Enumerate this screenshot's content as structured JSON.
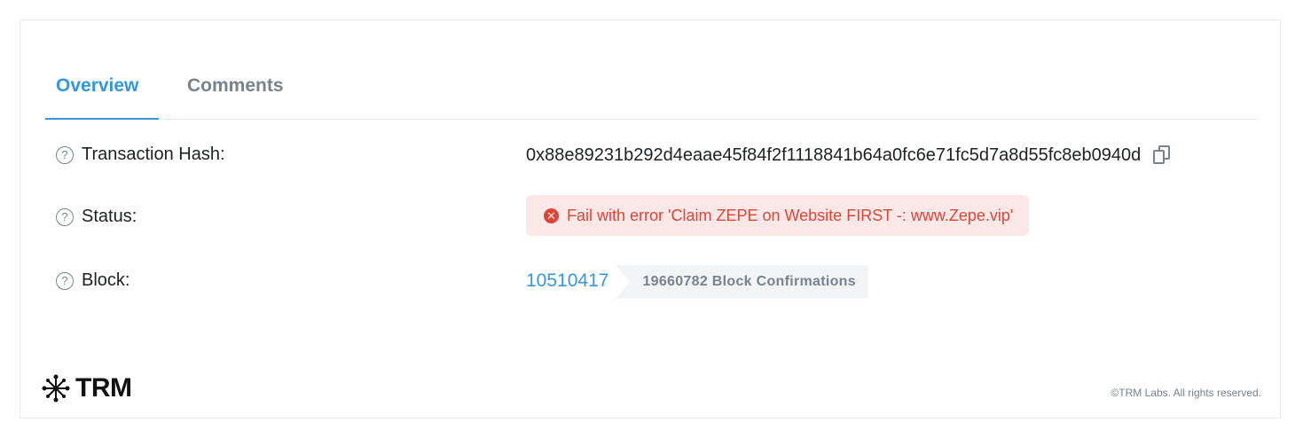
{
  "tabs": {
    "overview": "Overview",
    "comments": "Comments"
  },
  "rows": {
    "hash": {
      "label": "Transaction Hash:",
      "value": "0x88e89231b292d4eaae45f84f2f1118841b64a0fc6e71fc5d7a8d55fc8eb0940d"
    },
    "status": {
      "label": "Status:",
      "value": "Fail with error 'Claim ZEPE on Website FIRST -: www.Zepe.vip'"
    },
    "block": {
      "label": "Block:",
      "number": "10510417",
      "confirmations": "19660782 Block Confirmations"
    }
  },
  "footer": {
    "brand": "TRM",
    "copyright": "©TRM Labs. All rights reserved."
  },
  "icons": {
    "help": "question-circle-icon",
    "copy": "copy-icon",
    "error": "x-circle-icon",
    "brand": "trm-logo-mark"
  },
  "colors": {
    "accent": "#3498db",
    "error": "#de4437",
    "error_bg": "#fde8e8",
    "muted": "#77838f"
  }
}
